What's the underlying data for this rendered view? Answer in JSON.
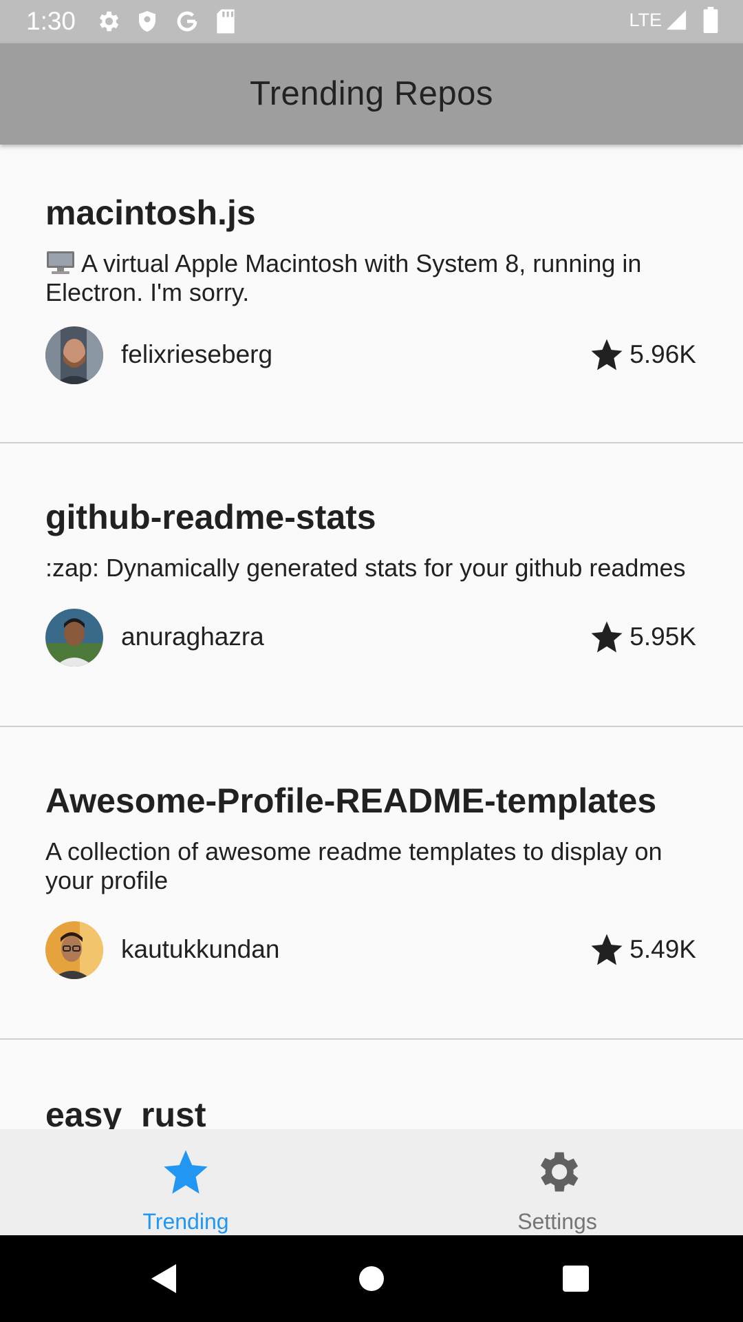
{
  "status_bar": {
    "time": "1:30",
    "network": "LTE",
    "icons": [
      "gear-icon",
      "shield-icon",
      "google-icon",
      "sd-card-icon",
      "signal-icon",
      "battery-icon"
    ]
  },
  "app_bar": {
    "title": "Trending Repos"
  },
  "repos": [
    {
      "name": "macintosh.js",
      "description_emoji": "computer-icon",
      "description": "A virtual Apple Macintosh with System 8, running in Electron. I'm sorry.",
      "owner": "felixrieseberg",
      "stars": "5.96K"
    },
    {
      "name": "github-readme-stats",
      "description": ":zap: Dynamically generated stats for your github readmes",
      "owner": "anuraghazra",
      "stars": "5.95K"
    },
    {
      "name": "Awesome-Profile-README-templates",
      "description": "A collection of awesome readme templates to display on your profile",
      "owner": "kautukkundan",
      "stars": "5.49K"
    },
    {
      "name": "easy_rust"
    }
  ],
  "bottom_nav": {
    "items": [
      {
        "label": "Trending",
        "icon": "star-icon",
        "active": true
      },
      {
        "label": "Settings",
        "icon": "gear-icon",
        "active": false
      }
    ]
  },
  "colors": {
    "status_bar": "#bdbdbd",
    "app_bar": "#9e9e9e",
    "accent": "#2196f3",
    "inactive": "#757575"
  }
}
